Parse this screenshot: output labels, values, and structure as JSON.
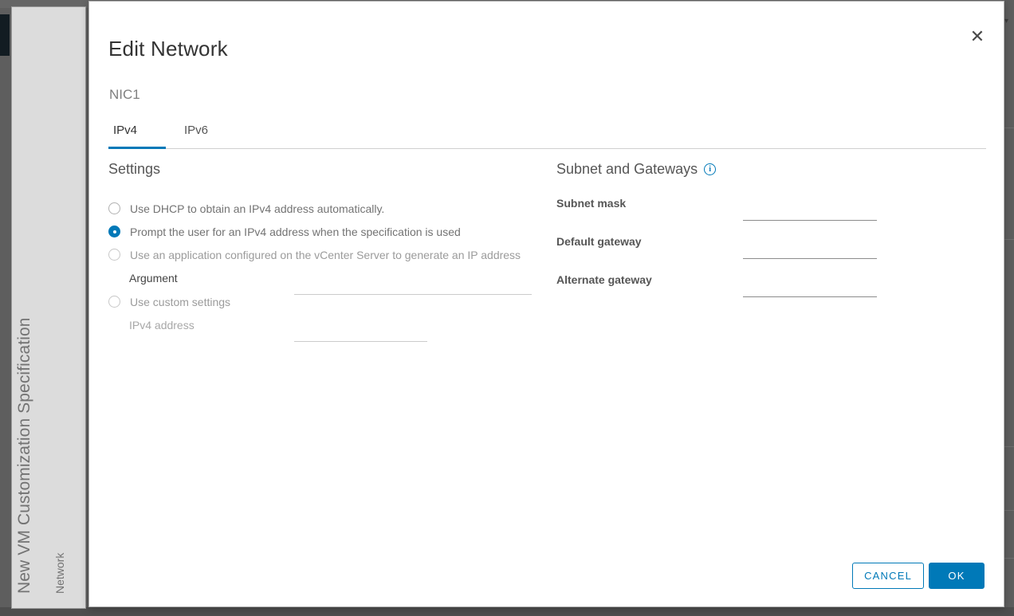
{
  "wizard": {
    "title": "New VM Customization Specification",
    "step": "Network"
  },
  "modal": {
    "title": "Edit Network",
    "subtitle": "NIC1",
    "close_label": "✕"
  },
  "tabs": [
    {
      "label": "IPv4",
      "active": true
    },
    {
      "label": "IPv6",
      "active": false
    }
  ],
  "settings": {
    "heading": "Settings",
    "options": [
      {
        "label": "Use DHCP to obtain an IPv4 address automatically.",
        "checked": false,
        "disabled": false
      },
      {
        "label": "Prompt the user for an IPv4 address when the specification is used",
        "checked": true,
        "disabled": false
      },
      {
        "label": "Use an application configured on the vCenter Server to generate an IP address",
        "checked": false,
        "disabled": true
      },
      {
        "label": "Use custom settings",
        "checked": false,
        "disabled": true
      }
    ],
    "argument": {
      "label": "Argument",
      "value": "",
      "placeholder": ""
    },
    "ipv4_address": {
      "label": "IPv4 address",
      "value": "",
      "placeholder": ""
    }
  },
  "subnet": {
    "heading": "Subnet and Gateways",
    "info_icon": "info-icon",
    "info_glyph": "i",
    "fields": [
      {
        "label": "Subnet mask",
        "value": "",
        "placeholder": ""
      },
      {
        "label": "Default gateway",
        "value": "",
        "placeholder": ""
      },
      {
        "label": "Alternate gateway",
        "value": "",
        "placeholder": ""
      }
    ]
  },
  "footer": {
    "cancel_label": "CANCEL",
    "ok_label": "OK"
  },
  "colors": {
    "accent": "#0079b8",
    "rail_bg": "#dcdcdc",
    "app_bg": "#5e5e5e",
    "text": "#565656"
  }
}
